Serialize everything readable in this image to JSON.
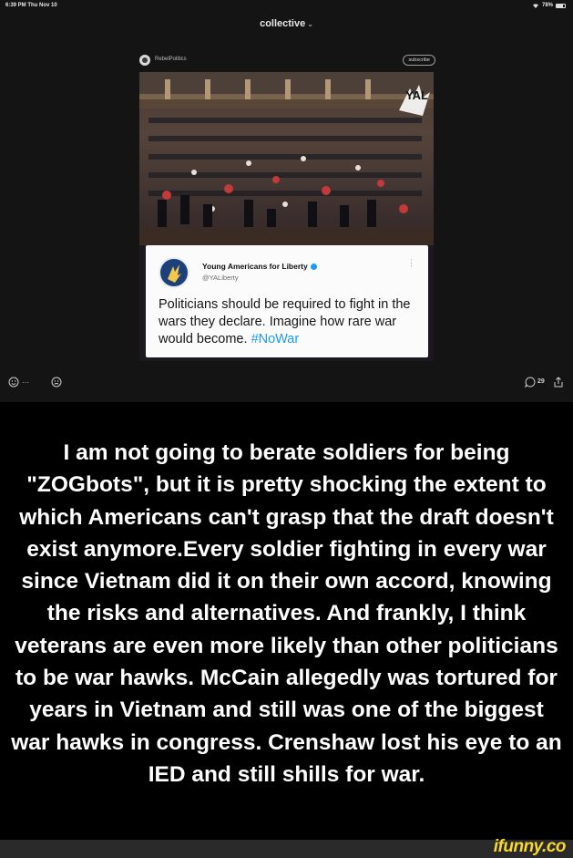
{
  "status_bar": {
    "time": "6:39 PM  Thu Nov 10",
    "battery": "78%"
  },
  "header": {
    "title": "collective",
    "chevron": "⌄"
  },
  "post": {
    "community": "RebelPolitics",
    "subscribe_label": "subscribe",
    "image_logo_text": "YAL",
    "tweet": {
      "name": "Young Americans for Liberty",
      "handle": "@YALiberty",
      "more": "⋮",
      "text": "Politicians should be required to fight in the wars they declare. Imagine how rare war would become.",
      "hashtag": "#NoWar"
    },
    "actions": {
      "react_more": "···",
      "comment_count": "29"
    }
  },
  "caption": "I am not going to berate soldiers for being \"ZOGbots\", but it is pretty shocking the extent to which Americans can't grasp that the draft doesn't exist anymore.Every soldier fighting in every war since Vietnam did it on their own accord, knowing the risks and alternatives. And frankly, I think veterans are even more likely than other politicians to be war hawks. McCain allegedly was tortured for years in Vietnam and still was one of the biggest war hawks in congress. Crenshaw lost his eye to an IED and still shills for war.",
  "watermark": "ifunny.co",
  "colors": {
    "accent_blue": "#1d9bf0",
    "ifunny_yellow": "#f9d72f",
    "app_background": "#141414"
  },
  "icons": [
    "wifi-icon",
    "battery-icon",
    "community-avatar",
    "verified-icon",
    "add-reaction-icon",
    "smiley-icon",
    "comment-icon",
    "share-icon"
  ]
}
